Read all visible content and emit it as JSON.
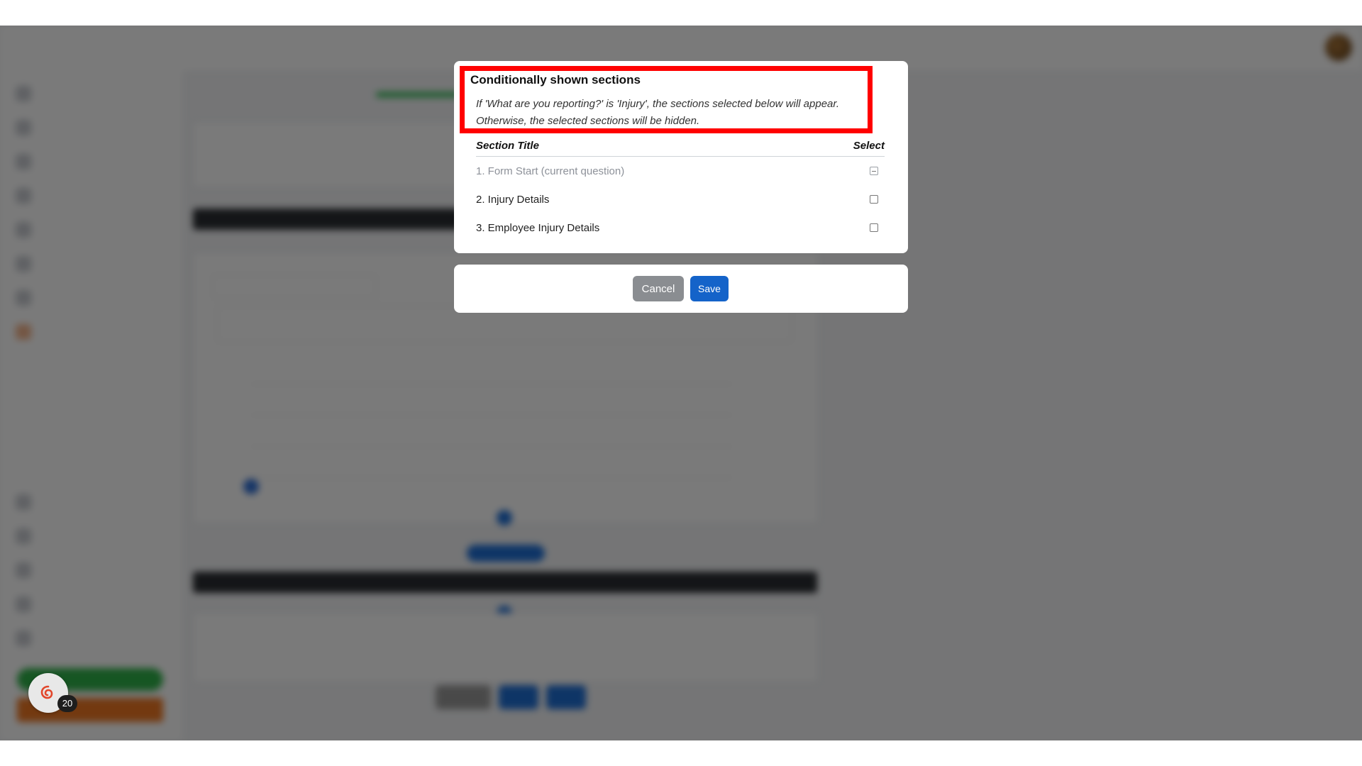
{
  "dialog": {
    "title": "Conditionally shown sections",
    "description": "If 'What are you reporting?' is 'Injury', the sections selected below will appear. Otherwise, the selected sections will be hidden.",
    "table": {
      "headers": {
        "title": "Section Title",
        "select": "Select"
      },
      "rows": [
        {
          "label": "1. Form Start (current question)",
          "state": "indeterminate",
          "disabled": true
        },
        {
          "label": "2. Injury Details",
          "state": "unchecked",
          "disabled": false
        },
        {
          "label": "3. Employee Injury Details",
          "state": "unchecked",
          "disabled": false
        }
      ]
    },
    "buttons": {
      "cancel": "Cancel",
      "save": "Save"
    }
  },
  "notification": {
    "count": "20"
  },
  "colors": {
    "highlight": "#ff0000",
    "save": "#1463c9",
    "cancel": "#8a8d91",
    "overlay": "rgba(0,0,0,0.52)"
  },
  "icons": {
    "floater": "swirl-logo-icon",
    "checkbox_indeterminate": "checkbox-indeterminate-icon",
    "checkbox_unchecked": "checkbox-unchecked-icon"
  }
}
